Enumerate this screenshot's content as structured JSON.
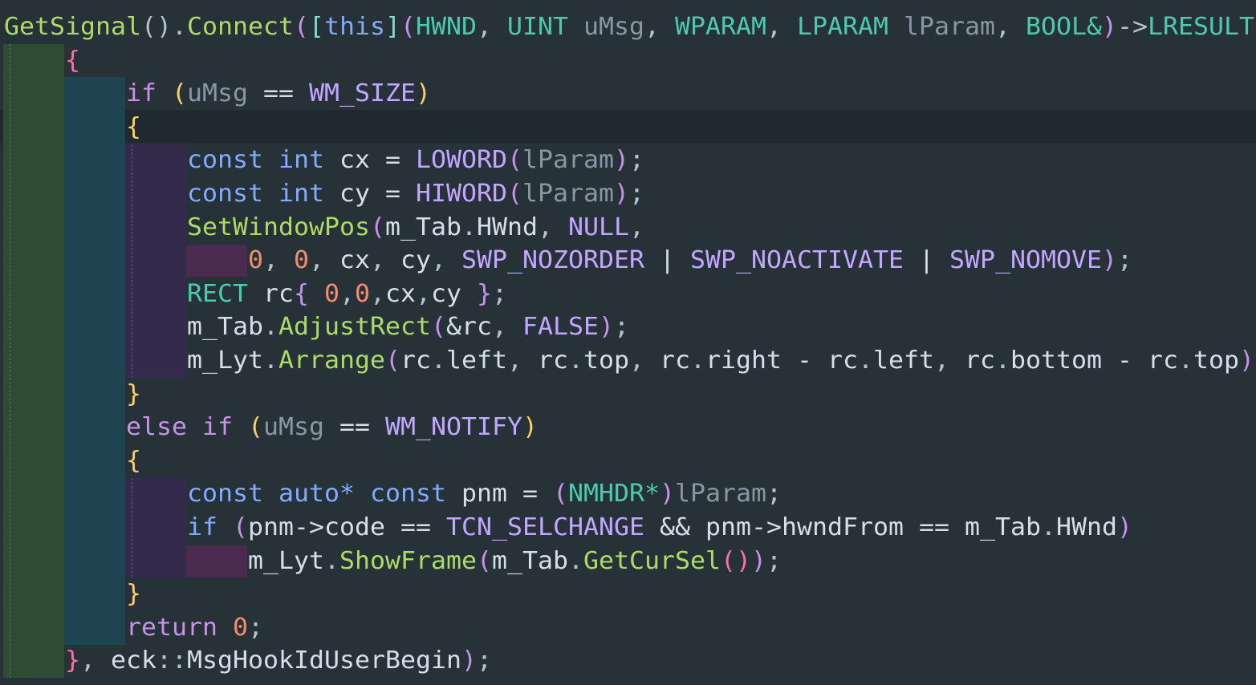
{
  "editor": {
    "language": "C++",
    "theme_colors": {
      "background": "#263238",
      "current_line": "#1f292e",
      "indent_level_1": "#2e4b34",
      "indent_level_2": "#1d4450",
      "indent_level_3": "#342b4c",
      "indent_level_4": "#4a2a4f"
    },
    "lines": [
      [
        [
          "",
          "ind"
        ],
        [
          "GetSignal",
          "fn"
        ],
        [
          "().",
          "pun"
        ],
        [
          "Connect",
          "fn"
        ],
        [
          "(",
          "par"
        ],
        [
          "[",
          "brk"
        ],
        [
          "this",
          "kw-this"
        ],
        [
          "]",
          "brk"
        ],
        [
          "(",
          "par"
        ],
        [
          "HWND",
          "type"
        ],
        [
          ", ",
          "pun"
        ],
        [
          "UINT",
          "type"
        ],
        [
          " ",
          "pun"
        ],
        [
          "uMsg",
          "param"
        ],
        [
          ", ",
          "pun"
        ],
        [
          "WPARAM",
          "type"
        ],
        [
          ", ",
          "pun"
        ],
        [
          "LPARAM",
          "type"
        ],
        [
          " ",
          "pun"
        ],
        [
          "lParam",
          "param"
        ],
        [
          ", ",
          "pun"
        ],
        [
          "BOOL&",
          "type"
        ],
        [
          ")",
          "par"
        ],
        [
          "->",
          "pun"
        ],
        [
          "LRESULT",
          "type"
        ]
      ],
      [
        [
          "    ",
          "ind"
        ],
        [
          "{",
          "brace1"
        ]
      ],
      [
        [
          "        ",
          "ind"
        ],
        [
          "if",
          "kw"
        ],
        [
          " ",
          "pun"
        ],
        [
          "(",
          "paren1"
        ],
        [
          "uMsg",
          "param"
        ],
        [
          " == ",
          "op"
        ],
        [
          "WM_SIZE",
          "macro"
        ],
        [
          ")",
          "paren1"
        ]
      ],
      [
        [
          "        ",
          "ind"
        ],
        [
          "{",
          "brace2"
        ]
      ],
      [
        [
          "            ",
          "ind"
        ],
        [
          "const",
          "kw2"
        ],
        [
          " ",
          "pun"
        ],
        [
          "int",
          "kw2"
        ],
        [
          " ",
          "pun"
        ],
        [
          "cx",
          "var"
        ],
        [
          " = ",
          "op"
        ],
        [
          "LOWORD",
          "macro"
        ],
        [
          "(",
          "par"
        ],
        [
          "lParam",
          "param"
        ],
        [
          ")",
          "par"
        ],
        [
          ";",
          "pun"
        ]
      ],
      [
        [
          "            ",
          "ind"
        ],
        [
          "const",
          "kw2"
        ],
        [
          " ",
          "pun"
        ],
        [
          "int",
          "kw2"
        ],
        [
          " ",
          "pun"
        ],
        [
          "cy",
          "var"
        ],
        [
          " = ",
          "op"
        ],
        [
          "HIWORD",
          "macro"
        ],
        [
          "(",
          "par"
        ],
        [
          "lParam",
          "param"
        ],
        [
          ")",
          "par"
        ],
        [
          ";",
          "pun"
        ]
      ],
      [
        [
          "            ",
          "ind"
        ],
        [
          "SetWindowPos",
          "fn"
        ],
        [
          "(",
          "par"
        ],
        [
          "m_Tab",
          "var"
        ],
        [
          ".",
          "pun"
        ],
        [
          "HWnd",
          "var"
        ],
        [
          ", ",
          "pun"
        ],
        [
          "NULL",
          "macro"
        ],
        [
          ",",
          "pun"
        ]
      ],
      [
        [
          "                ",
          "ind"
        ],
        [
          "0",
          "num"
        ],
        [
          ", ",
          "pun"
        ],
        [
          "0",
          "num"
        ],
        [
          ", ",
          "pun"
        ],
        [
          "cx",
          "var"
        ],
        [
          ", ",
          "pun"
        ],
        [
          "cy",
          "var"
        ],
        [
          ", ",
          "pun"
        ],
        [
          "SWP_NOZORDER",
          "macro"
        ],
        [
          " | ",
          "op"
        ],
        [
          "SWP_NOACTIVATE",
          "macro"
        ],
        [
          " | ",
          "op"
        ],
        [
          "SWP_NOMOVE",
          "macro"
        ],
        [
          ")",
          "par"
        ],
        [
          ";",
          "pun"
        ]
      ],
      [
        [
          "            ",
          "ind"
        ],
        [
          "RECT",
          "type"
        ],
        [
          " ",
          "pun"
        ],
        [
          "rc",
          "var"
        ],
        [
          "{",
          "par"
        ],
        [
          " ",
          "pun"
        ],
        [
          "0",
          "num"
        ],
        [
          ",",
          "pun"
        ],
        [
          "0",
          "num"
        ],
        [
          ",",
          "pun"
        ],
        [
          "cx",
          "var"
        ],
        [
          ",",
          "pun"
        ],
        [
          "cy",
          "var"
        ],
        [
          " ",
          "pun"
        ],
        [
          "}",
          "par"
        ],
        [
          ";",
          "pun"
        ]
      ],
      [
        [
          "            ",
          "ind"
        ],
        [
          "m_Tab",
          "var"
        ],
        [
          ".",
          "pun"
        ],
        [
          "AdjustRect",
          "fn"
        ],
        [
          "(",
          "par"
        ],
        [
          "&rc",
          "var"
        ],
        [
          ", ",
          "pun"
        ],
        [
          "FALSE",
          "macro"
        ],
        [
          ")",
          "par"
        ],
        [
          ";",
          "pun"
        ]
      ],
      [
        [
          "            ",
          "ind"
        ],
        [
          "m_Lyt",
          "var"
        ],
        [
          ".",
          "pun"
        ],
        [
          "Arrange",
          "fn"
        ],
        [
          "(",
          "par"
        ],
        [
          "rc",
          "var"
        ],
        [
          ".",
          "pun"
        ],
        [
          "left",
          "var"
        ],
        [
          ", ",
          "pun"
        ],
        [
          "rc",
          "var"
        ],
        [
          ".",
          "pun"
        ],
        [
          "top",
          "var"
        ],
        [
          ", ",
          "pun"
        ],
        [
          "rc",
          "var"
        ],
        [
          ".",
          "pun"
        ],
        [
          "right",
          "var"
        ],
        [
          " - ",
          "op"
        ],
        [
          "rc",
          "var"
        ],
        [
          ".",
          "pun"
        ],
        [
          "left",
          "var"
        ],
        [
          ", ",
          "pun"
        ],
        [
          "rc",
          "var"
        ],
        [
          ".",
          "pun"
        ],
        [
          "bottom",
          "var"
        ],
        [
          " - ",
          "op"
        ],
        [
          "rc",
          "var"
        ],
        [
          ".",
          "pun"
        ],
        [
          "top",
          "var"
        ],
        [
          ")",
          "par"
        ]
      ],
      [
        [
          "        ",
          "ind"
        ],
        [
          "}",
          "brace2"
        ]
      ],
      [
        [
          "        ",
          "ind"
        ],
        [
          "else",
          "kw"
        ],
        [
          " ",
          "pun"
        ],
        [
          "if",
          "kw"
        ],
        [
          " ",
          "pun"
        ],
        [
          "(",
          "paren1"
        ],
        [
          "uMsg",
          "param"
        ],
        [
          " == ",
          "op"
        ],
        [
          "WM_NOTIFY",
          "macro"
        ],
        [
          ")",
          "paren1"
        ]
      ],
      [
        [
          "        ",
          "ind"
        ],
        [
          "{",
          "brace2"
        ]
      ],
      [
        [
          "            ",
          "ind"
        ],
        [
          "const",
          "kw2"
        ],
        [
          " ",
          "pun"
        ],
        [
          "auto*",
          "kw2"
        ],
        [
          " ",
          "pun"
        ],
        [
          "const",
          "kw2"
        ],
        [
          " ",
          "pun"
        ],
        [
          "pnm",
          "var"
        ],
        [
          " = ",
          "op"
        ],
        [
          "(",
          "par"
        ],
        [
          "NMHDR*",
          "type"
        ],
        [
          ")",
          "par"
        ],
        [
          "lParam",
          "param"
        ],
        [
          ";",
          "pun"
        ]
      ],
      [
        [
          "            ",
          "ind"
        ],
        [
          "if",
          "kw2"
        ],
        [
          " ",
          "pun"
        ],
        [
          "(",
          "par"
        ],
        [
          "pnm",
          "var"
        ],
        [
          "->",
          "op"
        ],
        [
          "code",
          "var"
        ],
        [
          " == ",
          "op"
        ],
        [
          "TCN_SELCHANGE",
          "macro"
        ],
        [
          " && ",
          "op"
        ],
        [
          "pnm",
          "var"
        ],
        [
          "->",
          "op"
        ],
        [
          "hwndFrom",
          "var"
        ],
        [
          " == ",
          "op"
        ],
        [
          "m_Tab",
          "var"
        ],
        [
          ".",
          "pun"
        ],
        [
          "HWnd",
          "var"
        ],
        [
          ")",
          "par"
        ]
      ],
      [
        [
          "                ",
          "ind"
        ],
        [
          "m_Lyt",
          "var"
        ],
        [
          ".",
          "pun"
        ],
        [
          "ShowFrame",
          "fn"
        ],
        [
          "(",
          "par"
        ],
        [
          "m_Tab",
          "var"
        ],
        [
          ".",
          "pun"
        ],
        [
          "GetCurSel",
          "fn"
        ],
        [
          "()",
          "brace1"
        ],
        [
          ")",
          "par"
        ],
        [
          ";",
          "pun"
        ]
      ],
      [
        [
          "        ",
          "ind"
        ],
        [
          "}",
          "brace2"
        ]
      ],
      [
        [
          "        ",
          "ind"
        ],
        [
          "return",
          "kw"
        ],
        [
          " ",
          "pun"
        ],
        [
          "0",
          "num"
        ],
        [
          ";",
          "pun"
        ]
      ],
      [
        [
          "    ",
          "ind"
        ],
        [
          "}",
          "brace1"
        ],
        [
          ", ",
          "pun"
        ],
        [
          "eck",
          "var"
        ],
        [
          "::",
          "pun"
        ],
        [
          "MsgHookIdUserBegin",
          "var"
        ],
        [
          ")",
          "par"
        ],
        [
          ";",
          "pun"
        ]
      ]
    ]
  }
}
